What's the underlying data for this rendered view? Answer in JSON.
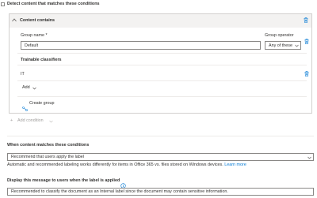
{
  "detect": {
    "label": "Detect content that matches these conditions"
  },
  "condition_group": {
    "title": "Content contains",
    "group_name_label": "Group name *",
    "group_name_value": "Default",
    "group_operator_label": "Group operator",
    "group_operator_value": "Any of these",
    "section_title": "Trainable classifiers",
    "classifier_item": "IT",
    "add_label": "Add",
    "create_group_label": "Create group"
  },
  "add_condition_label": "Add condition",
  "when_matches": {
    "heading": "When content matches these conditions",
    "dropdown_value": "Recommend that users apply the label",
    "help_text": "Automatic and recommended labeling works differently for items in Office 365 vs. files stored on Windows devices.",
    "learn_more": "Learn more"
  },
  "display_message": {
    "heading": "Display this message to users when the label is applied",
    "value": "Recommended to classify the document as an Internal label since the document may contain sensitive information."
  }
}
